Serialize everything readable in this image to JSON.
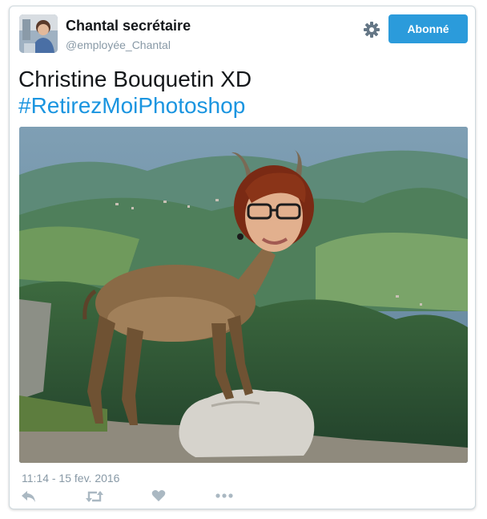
{
  "author": {
    "name": "Chantal secrétaire",
    "handle": "@employée_Chantal",
    "avatar": "avatar-photo"
  },
  "follow_button": {
    "label": "Abonné",
    "color": "#2b9bdb"
  },
  "tweet": {
    "text": "Christine Bouquetin XD",
    "hashtag": "#RetirezMoiPhotoshop",
    "hashtag_color": "#1b95e0",
    "image": "photomontage-ibex-with-woman-head-mountain-landscape",
    "timestamp": "11:14 - 15 fev. 2016"
  },
  "icons": {
    "settings": "gear-icon",
    "actions": [
      "reply-icon",
      "retweet-icon",
      "like-icon",
      "more-icon"
    ]
  }
}
